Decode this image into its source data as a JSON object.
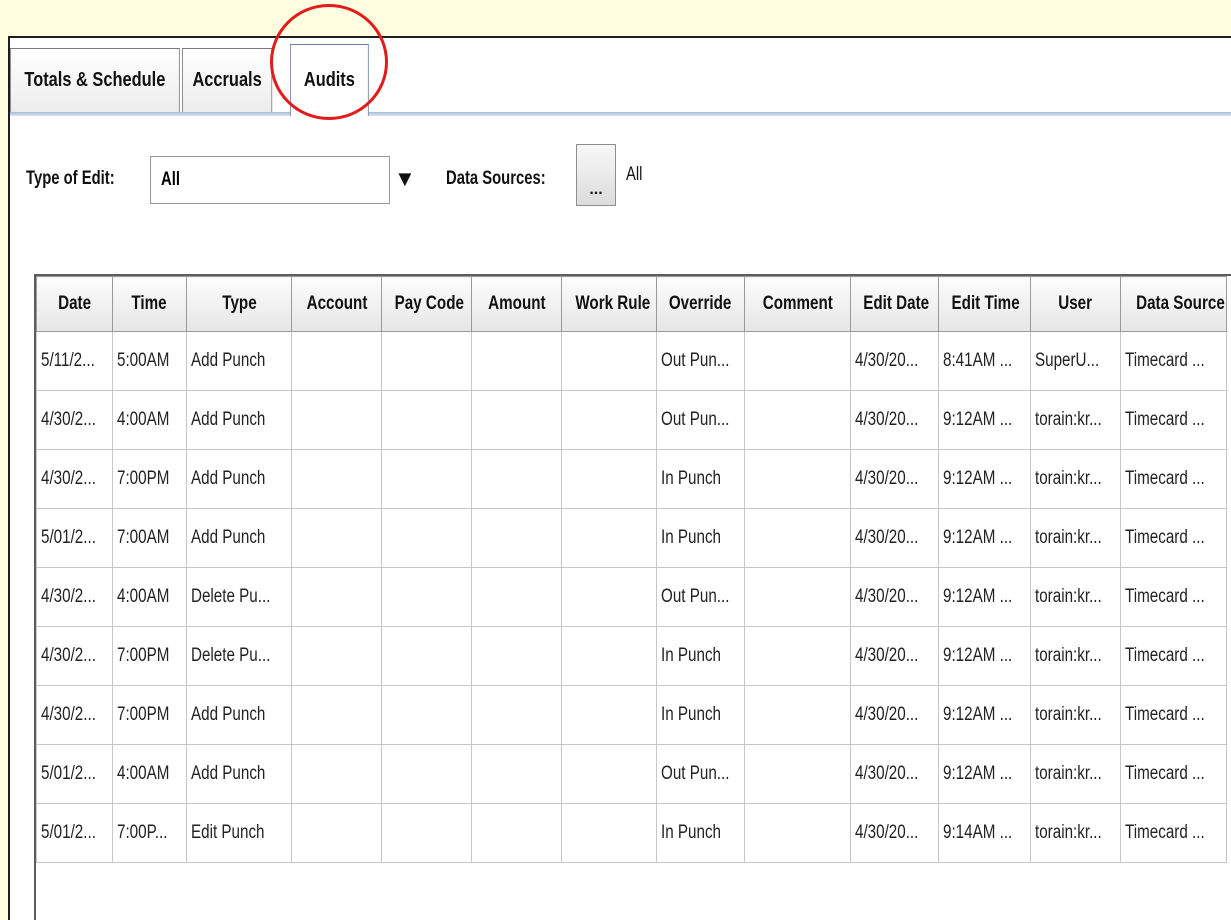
{
  "tabs": [
    {
      "label": "Totals & Schedule",
      "active": false
    },
    {
      "label": "Accruals",
      "active": false
    },
    {
      "label": "Audits",
      "active": true
    }
  ],
  "filters": {
    "type_of_edit_label": "Type of Edit:",
    "type_of_edit_value": "All",
    "data_sources_label": "Data Sources:",
    "data_sources_button": "...",
    "data_sources_value": "All"
  },
  "table": {
    "columns": [
      "Date",
      "Time",
      "Type",
      "Account",
      "Pay Code",
      "Amount",
      "Work Rule",
      "Override",
      "Comment",
      "Edit Date",
      "Edit Time",
      "User",
      "Data Source"
    ],
    "rows": [
      [
        "5/11/2...",
        "5:00AM",
        "Add Punch",
        "",
        "",
        "",
        "",
        "Out Pun...",
        "",
        "4/30/20...",
        "8:41AM ...",
        "SuperU...",
        "Timecard ..."
      ],
      [
        "4/30/2...",
        "4:00AM",
        "Add Punch",
        "",
        "",
        "",
        "",
        "Out Pun...",
        "",
        "4/30/20...",
        "9:12AM ...",
        "torain:kr...",
        "Timecard ..."
      ],
      [
        "4/30/2...",
        "7:00PM",
        "Add Punch",
        "",
        "",
        "",
        "",
        "In Punch",
        "",
        "4/30/20...",
        "9:12AM ...",
        "torain:kr...",
        "Timecard ..."
      ],
      [
        "5/01/2...",
        "7:00AM",
        "Add Punch",
        "",
        "",
        "",
        "",
        "In Punch",
        "",
        "4/30/20...",
        "9:12AM ...",
        "torain:kr...",
        "Timecard ..."
      ],
      [
        "4/30/2...",
        "4:00AM",
        "Delete Pu...",
        "",
        "",
        "",
        "",
        "Out Pun...",
        "",
        "4/30/20...",
        "9:12AM ...",
        "torain:kr...",
        "Timecard ..."
      ],
      [
        "4/30/2...",
        "7:00PM",
        "Delete Pu...",
        "",
        "",
        "",
        "",
        "In Punch",
        "",
        "4/30/20...",
        "9:12AM ...",
        "torain:kr...",
        "Timecard ..."
      ],
      [
        "4/30/2...",
        "7:00PM",
        "Add Punch",
        "",
        "",
        "",
        "",
        "In Punch",
        "",
        "4/30/20...",
        "9:12AM ...",
        "torain:kr...",
        "Timecard ..."
      ],
      [
        "5/01/2...",
        "4:00AM",
        "Add Punch",
        "",
        "",
        "",
        "",
        "Out Pun...",
        "",
        "4/30/20...",
        "9:12AM ...",
        "torain:kr...",
        "Timecard ..."
      ],
      [
        "5/01/2...",
        "7:00P...",
        "Edit Punch",
        "",
        "",
        "",
        "",
        "In Punch",
        "",
        "4/30/20...",
        "9:14AM ...",
        "torain:kr...",
        "Timecard ..."
      ]
    ]
  },
  "colors": {
    "page_background": "#fffee0",
    "highlight_circle": "#e21b1b",
    "tab_underline": "#a7bad9"
  }
}
